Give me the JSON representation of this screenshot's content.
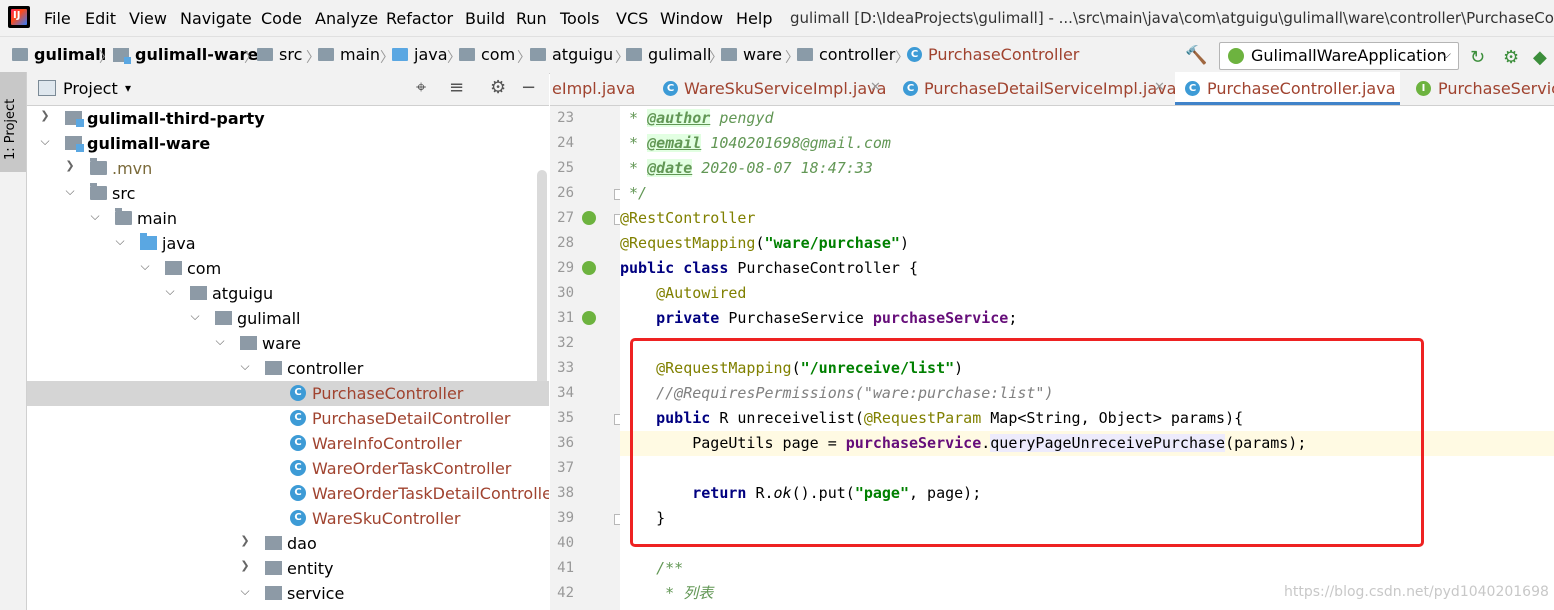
{
  "menubar": {
    "items": [
      "File",
      "Edit",
      "View",
      "Navigate",
      "Code",
      "Analyze",
      "Refactor",
      "Build",
      "Run",
      "Tools",
      "VCS",
      "Window",
      "Help"
    ],
    "window_title": "gulimall [D:\\IdeaProjects\\gulimall] - ...\\src\\main\\java\\com\\atguigu\\gulimall\\ware\\controller\\PurchaseContr"
  },
  "breadcrumb": [
    "gulimall",
    "gulimall-ware",
    "src",
    "main",
    "java",
    "com",
    "atguigu",
    "gulimall",
    "ware",
    "controller",
    "PurchaseController"
  ],
  "run_config": "GulimallWareApplication",
  "project_panel": {
    "stripe_label": "1: Project",
    "title": "Project"
  },
  "tree": [
    {
      "label": "gulimall-third-party",
      "depth": 0,
      "icon": "module",
      "arrow": "collapsed",
      "bold": true
    },
    {
      "label": "gulimall-ware",
      "depth": 0,
      "icon": "module",
      "arrow": "expanded",
      "bold": true
    },
    {
      "label": ".mvn",
      "depth": 1,
      "icon": "folder",
      "arrow": "collapsed"
    },
    {
      "label": "src",
      "depth": 1,
      "icon": "folder",
      "arrow": "expanded"
    },
    {
      "label": "main",
      "depth": 2,
      "icon": "folder",
      "arrow": "expanded"
    },
    {
      "label": "java",
      "depth": 3,
      "icon": "java-folder",
      "arrow": "expanded"
    },
    {
      "label": "com",
      "depth": 4,
      "icon": "package",
      "arrow": "expanded"
    },
    {
      "label": "atguigu",
      "depth": 5,
      "icon": "package",
      "arrow": "expanded"
    },
    {
      "label": "gulimall",
      "depth": 6,
      "icon": "package",
      "arrow": "expanded"
    },
    {
      "label": "ware",
      "depth": 7,
      "icon": "package",
      "arrow": "expanded"
    },
    {
      "label": "controller",
      "depth": 8,
      "icon": "package",
      "arrow": "expanded"
    },
    {
      "label": "PurchaseController",
      "depth": 9,
      "icon": "class",
      "selected": true
    },
    {
      "label": "PurchaseDetailController",
      "depth": 9,
      "icon": "class"
    },
    {
      "label": "WareInfoController",
      "depth": 9,
      "icon": "class"
    },
    {
      "label": "WareOrderTaskController",
      "depth": 9,
      "icon": "class"
    },
    {
      "label": "WareOrderTaskDetailController",
      "depth": 9,
      "icon": "class"
    },
    {
      "label": "WareSkuController",
      "depth": 9,
      "icon": "class"
    },
    {
      "label": "dao",
      "depth": 8,
      "icon": "package",
      "arrow": "collapsed"
    },
    {
      "label": "entity",
      "depth": 8,
      "icon": "package",
      "arrow": "collapsed"
    },
    {
      "label": "service",
      "depth": 8,
      "icon": "package",
      "arrow": "expanded"
    }
  ],
  "editor_tabs": [
    {
      "label": "eImpl.java",
      "icon": "none"
    },
    {
      "label": "WareSkuServiceImpl.java",
      "icon": "class"
    },
    {
      "label": "PurchaseDetailServiceImpl.java",
      "icon": "class"
    },
    {
      "label": "PurchaseController.java",
      "icon": "class",
      "active": true
    },
    {
      "label": "PurchaseService",
      "icon": "interface"
    }
  ],
  "code": {
    "line_numbers": [
      "23",
      "24",
      "25",
      "26",
      "27",
      "28",
      "29",
      "30",
      "31",
      "32",
      "33",
      "34",
      "35",
      "36",
      "37",
      "38",
      "39",
      "40",
      "41",
      "42"
    ],
    "author_tag": "@author",
    "author": " pengyd",
    "email_tag": "@email",
    "email": " 1040201698@gmail.com",
    "date_tag": "@date",
    "date": " 2020-08-07 18:47:33",
    "close_comment": " */",
    "rest_controller": "@RestController",
    "request_mapping": "@RequestMapping",
    "request_mapping_path": "\"ware/purchase\"",
    "kw_public": "public",
    "kw_class": "class",
    "class_name": " PurchaseController {",
    "autowired": "@Autowired",
    "kw_private": "private",
    "service_type": " PurchaseService ",
    "service_field": "purchaseService",
    "semicolon": ";",
    "method_mapping_path": "\"/unreceive/list\"",
    "requires_permissions": "//@RequiresPermissions(\"ware:purchase:list\")",
    "return_type": " R ",
    "method_name": "unreceivelist",
    "request_param": "@RequestParam",
    "params_decl": " Map<String, Object> params){",
    "page_decl": "PageUtils page = ",
    "query_method": "queryPageUnreceivePurchase",
    "query_args": "(params);",
    "kw_return": "return",
    "return_expr_1": " R.",
    "ok_method": "ok",
    "return_expr_2": "().put(",
    "page_key": "\"page\"",
    "return_expr_3": ", page);",
    "close_brace": "}",
    "javadoc_open": "/**",
    "javadoc_list": " * 列表",
    "star": " * "
  },
  "watermark": "https://blog.csdn.net/pyd1040201698",
  "colors": {
    "keyword": "#000080",
    "annotation": "#808000",
    "string": "#008000",
    "highlight_box": "#ee2222"
  }
}
